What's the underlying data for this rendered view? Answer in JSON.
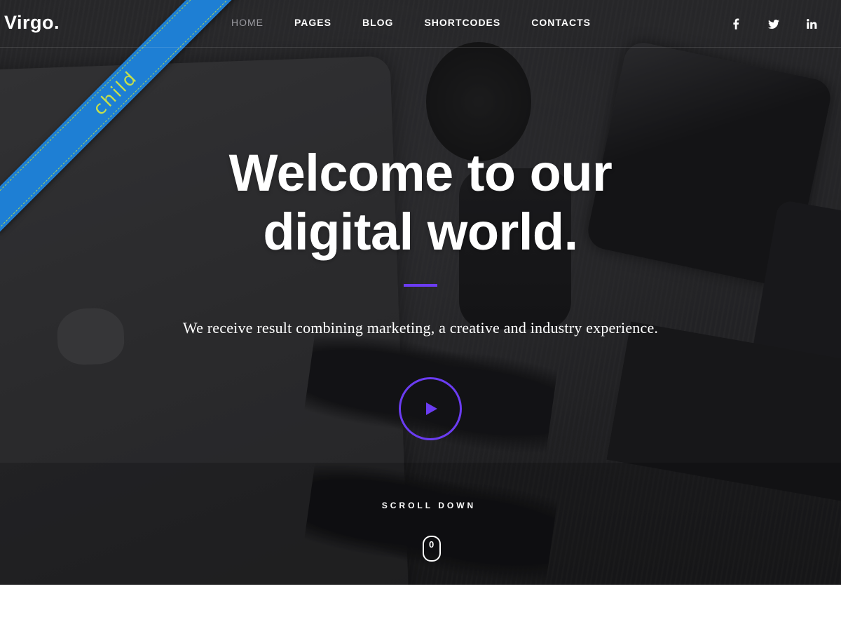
{
  "header": {
    "logo": "Virgo.",
    "nav": [
      {
        "label": "HOME",
        "active": true
      },
      {
        "label": "PAGES",
        "active": false
      },
      {
        "label": "BLOG",
        "active": false
      },
      {
        "label": "SHORTCODES",
        "active": false
      },
      {
        "label": "CONTACTS",
        "active": false
      }
    ],
    "social": [
      {
        "icon": "facebook-icon",
        "glyph": "f"
      },
      {
        "icon": "twitter-icon",
        "glyph": "t"
      },
      {
        "icon": "linkedin-icon",
        "glyph": "in"
      }
    ]
  },
  "ribbon": {
    "text": "child",
    "color": "#1e7fd4",
    "text_color": "#c6e04a"
  },
  "hero": {
    "headline_line1": "Welcome to our",
    "headline_line2": "digital world.",
    "subtitle": "We receive result combining marketing, a creative and industry experience.",
    "accent_color": "#6b3cf2",
    "play_icon": "play-icon",
    "scroll_label": "SCROLL DOWN",
    "scroll_icon": "mouse-scroll-icon",
    "mouse_wheel": "0"
  }
}
